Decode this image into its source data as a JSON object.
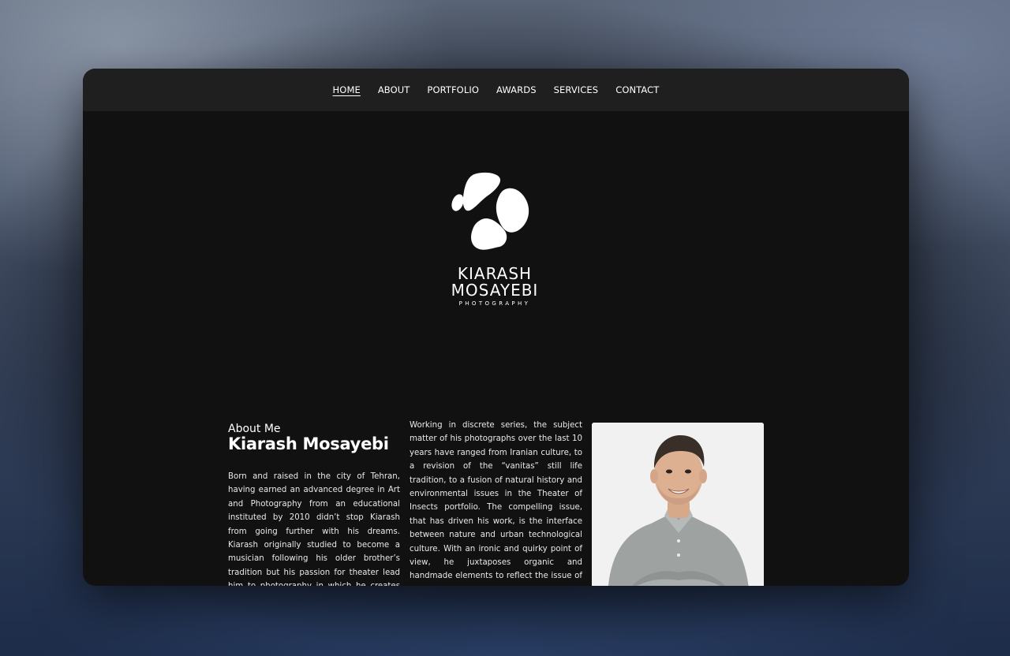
{
  "nav": {
    "items": [
      {
        "label": "HOME",
        "active": true
      },
      {
        "label": "ABOUT"
      },
      {
        "label": "PORTFOLIO"
      },
      {
        "label": "AWARDS"
      },
      {
        "label": "SERVICES"
      },
      {
        "label": "CONTACT"
      }
    ]
  },
  "logo": {
    "line1": "KIARASH",
    "line2": "MOSAYEBI",
    "line3": "PHOTOGRAPHY",
    "icon": "pebble-mark-icon"
  },
  "about": {
    "label": "About Me",
    "name": "Kiarash Mosayebi",
    "bio": "Born and raised in the city of Tehran, having earned an advanced degree in Art and Photography from an educational instituted by 2010 didn’t stop Kiarash from going further with his dreams. Kiarash originally studied to become a musician following his older brother’s tradition but his passion for theater lead him to photography in which he creates stage sets and employs numerous props",
    "work": "Working in discrete series, the subject matter of his photographs over the last 10 years have ranged from Iranian culture, to a revision of the “vanitas” still life tradition, to a fusion of natural history and environmental issues in the Theater of Insects portfolio. The compelling issue, that has driven his work, is the interface between nature and urban technological culture. With an ironic and quirky point of view, he juxtaposes organic and handmade elements to reflect the issue of environmental degradation in an imaginative manner."
  },
  "colors": {
    "window_bg": "#111111",
    "nav_bg": "#1f1f1f",
    "text": "#ffffff"
  }
}
